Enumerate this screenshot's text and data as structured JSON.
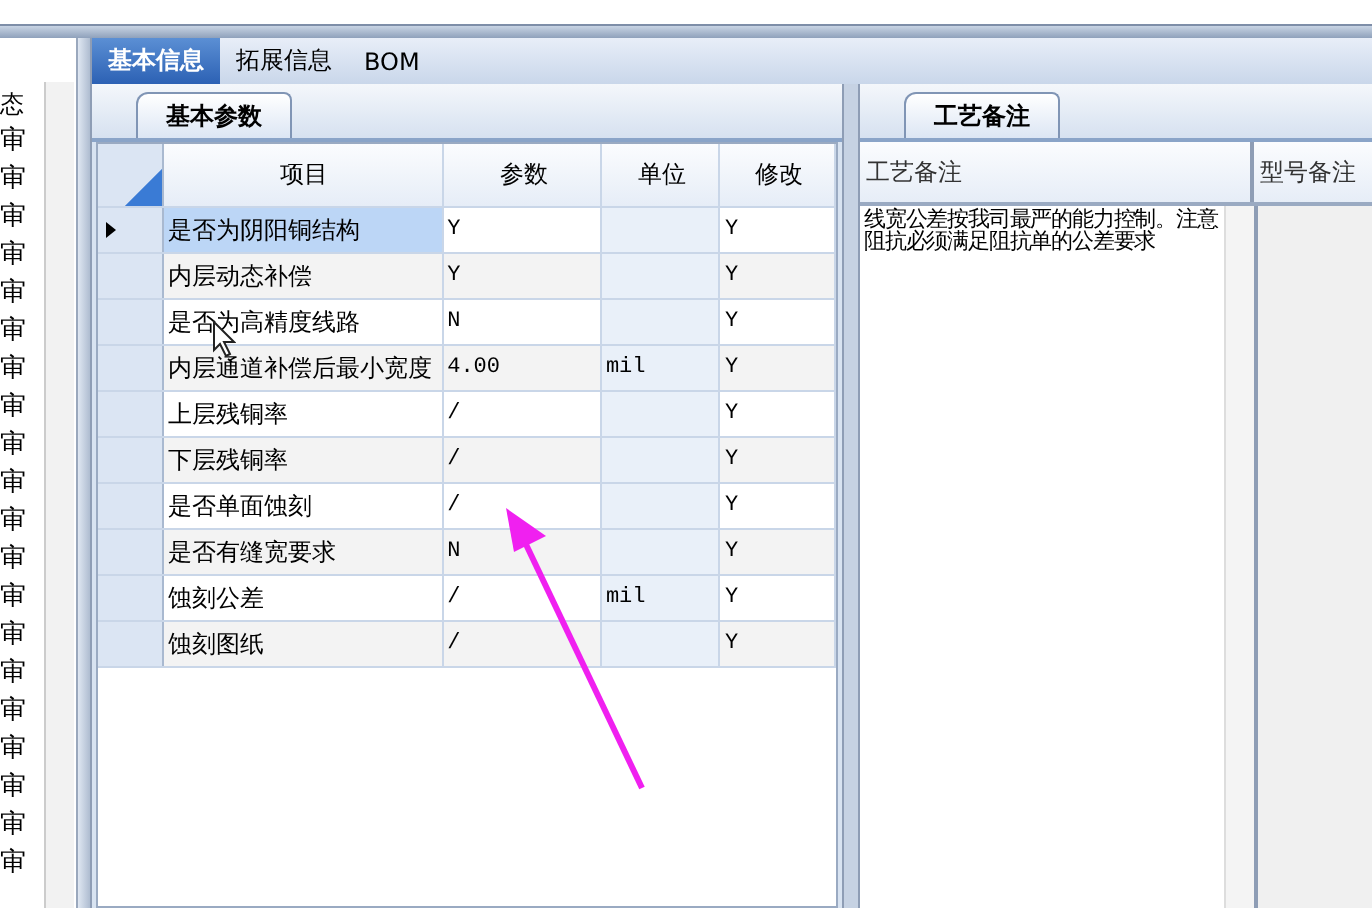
{
  "left_list": {
    "header": "态",
    "rows": [
      "审",
      "审",
      "审",
      "审",
      "审",
      "审",
      "审",
      "审",
      "审",
      "审",
      "审",
      "审",
      "审",
      "审",
      "审",
      "审",
      "审",
      "审",
      "审",
      "审"
    ]
  },
  "tabs": [
    {
      "label": "基本信息",
      "selected": true
    },
    {
      "label": "拓展信息",
      "selected": false
    },
    {
      "label": "BOM",
      "selected": false
    }
  ],
  "params_panel": {
    "tab": "基本参数",
    "columns": [
      "项目",
      "参数",
      "单位",
      "修改"
    ],
    "rows": [
      {
        "item": "是否为阴阳铜结构",
        "value": "Y",
        "unit": "",
        "modified": "Y",
        "selected": true
      },
      {
        "item": "内层动态补偿",
        "value": "Y",
        "unit": "",
        "modified": "Y",
        "selected": false
      },
      {
        "item": "是否为高精度线路",
        "value": "N",
        "unit": "",
        "modified": "Y",
        "selected": false
      },
      {
        "item": "内层通道补偿后最小宽度",
        "value": "4.00",
        "unit": "mil",
        "modified": "Y",
        "selected": false
      },
      {
        "item": "上层残铜率",
        "value": "/",
        "unit": "",
        "modified": "Y",
        "selected": false
      },
      {
        "item": "下层残铜率",
        "value": "/",
        "unit": "",
        "modified": "Y",
        "selected": false
      },
      {
        "item": "是否单面蚀刻",
        "value": "/",
        "unit": "",
        "modified": "Y",
        "selected": false
      },
      {
        "item": "是否有缝宽要求",
        "value": "N",
        "unit": "",
        "modified": "Y",
        "selected": false
      },
      {
        "item": "蚀刻公差",
        "value": "/",
        "unit": "mil",
        "modified": "Y",
        "selected": false
      },
      {
        "item": "蚀刻图纸",
        "value": "/",
        "unit": "",
        "modified": "Y",
        "selected": false
      }
    ]
  },
  "notes_panel": {
    "tab": "工艺备注",
    "columns": [
      "工艺备注",
      "型号备注"
    ],
    "process_note": "线宽公差按我司最严的能力控制。注意阻抗必须满足阻抗单的公差要求"
  }
}
